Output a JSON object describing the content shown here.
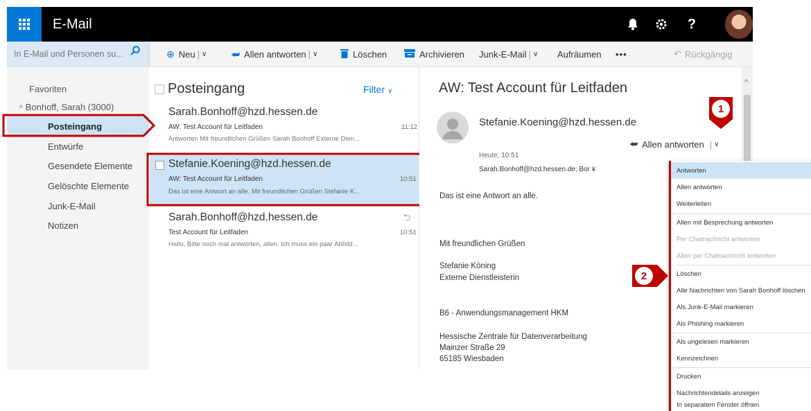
{
  "app": {
    "title": "E-Mail"
  },
  "search": {
    "placeholder": "In E-Mail und Personen su..."
  },
  "toolbar": {
    "new_label": "Neu",
    "reply_all_label": "Allen antworten",
    "delete_label": "Löschen",
    "archive_label": "Archivieren",
    "junk_label": "Junk-E-Mail",
    "sweep_label": "Aufräumen",
    "more_label": "•••",
    "undo_label": "Rückgängig",
    "sep": "|"
  },
  "nav": {
    "favorites": "Favoriten",
    "account": "Bonhoff, Sarah (3000)",
    "items": [
      "Posteingang",
      "Entwürfe",
      "Gesendete Elemente",
      "Gelöschte Elemente",
      "Junk-E-Mail",
      "Notizen"
    ]
  },
  "list": {
    "title": "Posteingang",
    "filter": "Filter",
    "messages": [
      {
        "sender": "Sarah.Bonhoff@hzd.hessen.de",
        "subject": "AW: Test Account für Leitfaden",
        "time": "11:12",
        "preview": "Antworten Mit freundlichen Grüßen Sarah Bonhoff Externe Dien..."
      },
      {
        "sender": "Stefanie.Koening@hzd.hessen.de",
        "subject": "AW: Test Account für Leitfaden",
        "time": "10:51",
        "preview": "Das ist eine Antwort an alle. Mit freundlichen Grüßen Stefanie K..."
      },
      {
        "sender": "Sarah.Bonhoff@hzd.hessen.de",
        "subject": "Test Account für Leitfaden",
        "time": "10:51",
        "preview": "Hallo, Bitte noch mal antworten, allen. Ich muss ein paar Abbild..."
      }
    ]
  },
  "reading": {
    "subject": "AW: Test Account für Leitfaden",
    "from": "Stefanie.Koening@hzd.hessen.de",
    "reply_all": "Allen antworten",
    "date": "Heute, 10:51",
    "to": "Sarah.Bonhoff@hzd.hessen.de; Bor",
    "body": [
      "Das ist eine Antwort an alle.",
      "Mit freundlichen Grüßen",
      "Stefanie Köning",
      "Externe Dienstleisterin",
      "B6 - Anwendungsmanagement HKM",
      "Hessische Zentrale für Datenverarbeitung",
      "Mainzer Straße 29",
      "65185 Wiesbaden"
    ]
  },
  "menu": {
    "items": [
      "Antworten",
      "Allen antworten",
      "Weiterleiten",
      "Allen mit Besprechung antworten",
      "Per Chatnachricht antworten",
      "Allen per Chatnachricht antworten",
      "Löschen",
      "Alle Nachrichten von Sarah Bonhoff löschen",
      "Als Junk-E-Mail markieren",
      "Als Phishing markieren",
      "Als ungelesen markieren",
      "Kennzeichnen",
      "Drucken",
      "Nachrichtendetails anzeigen",
      "In separatem Fenster öffnen"
    ]
  },
  "badges": {
    "one": "1",
    "two": "2"
  },
  "colors": {
    "brand": "#0078d7",
    "selected": "#cde4f7",
    "callout": "#c00000"
  }
}
